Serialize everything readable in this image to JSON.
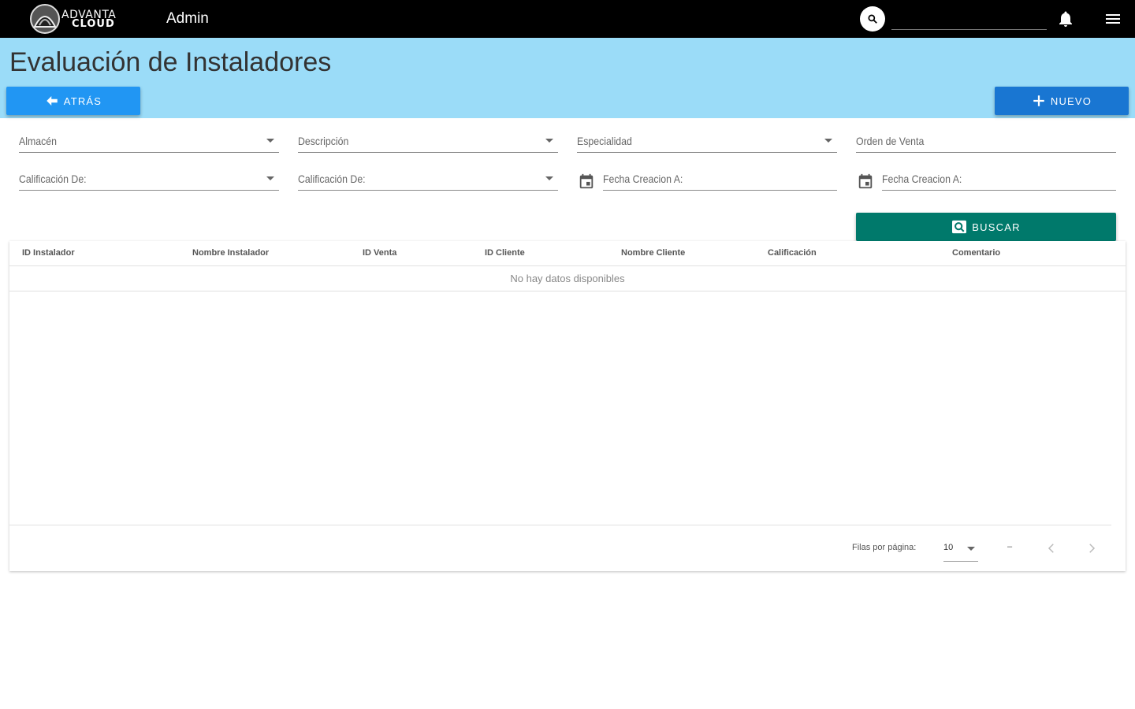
{
  "topbar": {
    "logo_line1": "ADVANTA",
    "logo_line2": "CLOUD",
    "title": "Admin",
    "search_value": "",
    "icons": [
      "search-icon",
      "bell-icon",
      "menu-icon"
    ]
  },
  "header": {
    "title": "Evaluación de Instaladores",
    "back_label": "ATRÁS",
    "new_label": "NUEVO"
  },
  "filters": {
    "almacen": "Almacén",
    "descripcion": "Descripción",
    "especialidad": "Especialidad",
    "orden_venta": "Orden de Venta",
    "calificacion_de_1": "Calificación De:",
    "calificacion_de_2": "Calificación De:",
    "fecha_creacion_1": "Fecha Creacion A:",
    "fecha_creacion_2": "Fecha Creacion A:",
    "search_label": "BUSCAR"
  },
  "table": {
    "columns": [
      "ID Instalador",
      "Nombre Instalador",
      "ID Venta",
      "ID Cliente",
      "Nombre Cliente",
      "Calificación",
      "Comentario"
    ],
    "empty_text": "No hay datos disponibles"
  },
  "pagination": {
    "rows_label": "Filas por página:",
    "rows_value": "10",
    "range": "–"
  },
  "colors": {
    "topbar": "#000000",
    "header_band": "#9bdcf8",
    "back_button": "#2196f3",
    "new_button": "#1976d2",
    "search_button": "#00796b"
  }
}
